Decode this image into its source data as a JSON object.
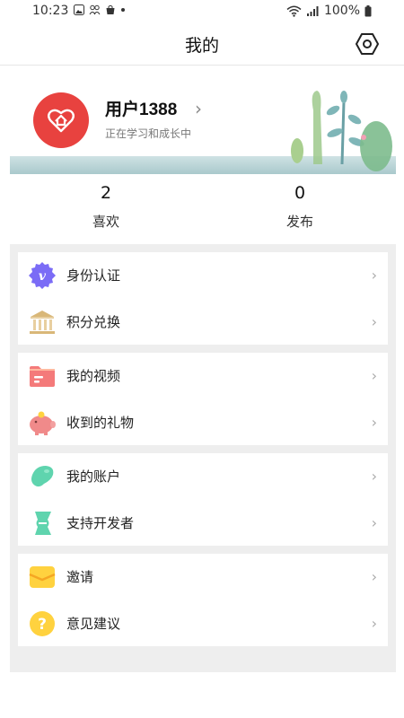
{
  "status": {
    "time": "10:23",
    "battery": "100%"
  },
  "header": {
    "title": "我的"
  },
  "profile": {
    "name": "用户1388",
    "subtitle": "正在学习和成长中"
  },
  "stats": [
    {
      "value": "2",
      "label": "喜欢"
    },
    {
      "value": "0",
      "label": "发布"
    }
  ],
  "menu": [
    [
      {
        "label": "身份认证",
        "icon": "vimeo-icon",
        "color": "#7b6cf6"
      },
      {
        "label": "积分兑换",
        "icon": "bank-icon",
        "color": "#d9b778"
      }
    ],
    [
      {
        "label": "我的视频",
        "icon": "folder-icon",
        "color": "#f47a7a"
      },
      {
        "label": "收到的礼物",
        "icon": "piggy-bank-icon",
        "color": "#f08a8a"
      }
    ],
    [
      {
        "label": "我的账户",
        "icon": "bean-icon",
        "color": "#5fd4ae"
      },
      {
        "label": "支持开发者",
        "icon": "ticket-icon",
        "color": "#5fd4ae"
      }
    ],
    [
      {
        "label": "邀请",
        "icon": "mail-icon",
        "color": "#ffd23f"
      },
      {
        "label": "意见建议",
        "icon": "question-icon",
        "color": "#ffd23f"
      }
    ]
  ]
}
